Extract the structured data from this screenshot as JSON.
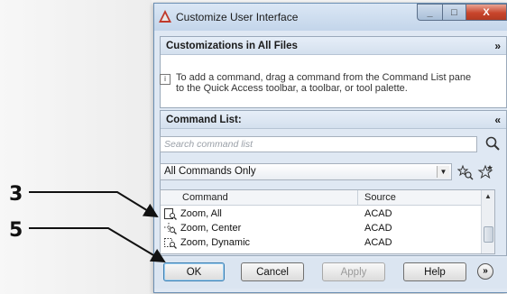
{
  "callouts": [
    {
      "label": "3"
    },
    {
      "label": "5"
    }
  ],
  "window": {
    "title": "Customize User Interface",
    "controls": {
      "minimize": "_",
      "maximize": "□",
      "close": "X"
    }
  },
  "customizations_section": {
    "title": "Customizations in All Files",
    "toggle": "»"
  },
  "info": {
    "icon": "i",
    "line1": "To add a command, drag a command from the Command List pane",
    "line2": "to the Quick Access toolbar, a toolbar, or tool palette."
  },
  "command_list": {
    "title": "Command List:",
    "toggle": "«",
    "search_placeholder": "Search command list",
    "filter_value": "All Commands Only",
    "columns": {
      "command": "Command",
      "source": "Source"
    },
    "rows": [
      {
        "command": "Zoom, All",
        "source": "ACAD",
        "icon": "zoom-all-icon"
      },
      {
        "command": "Zoom, Center",
        "source": "ACAD",
        "icon": "zoom-center-icon"
      },
      {
        "command": "Zoom, Dynamic",
        "source": "ACAD",
        "icon": "zoom-dynamic-icon"
      }
    ]
  },
  "buttons": {
    "ok": "OK",
    "cancel": "Cancel",
    "apply": "Apply",
    "help": "Help",
    "more": "»"
  }
}
